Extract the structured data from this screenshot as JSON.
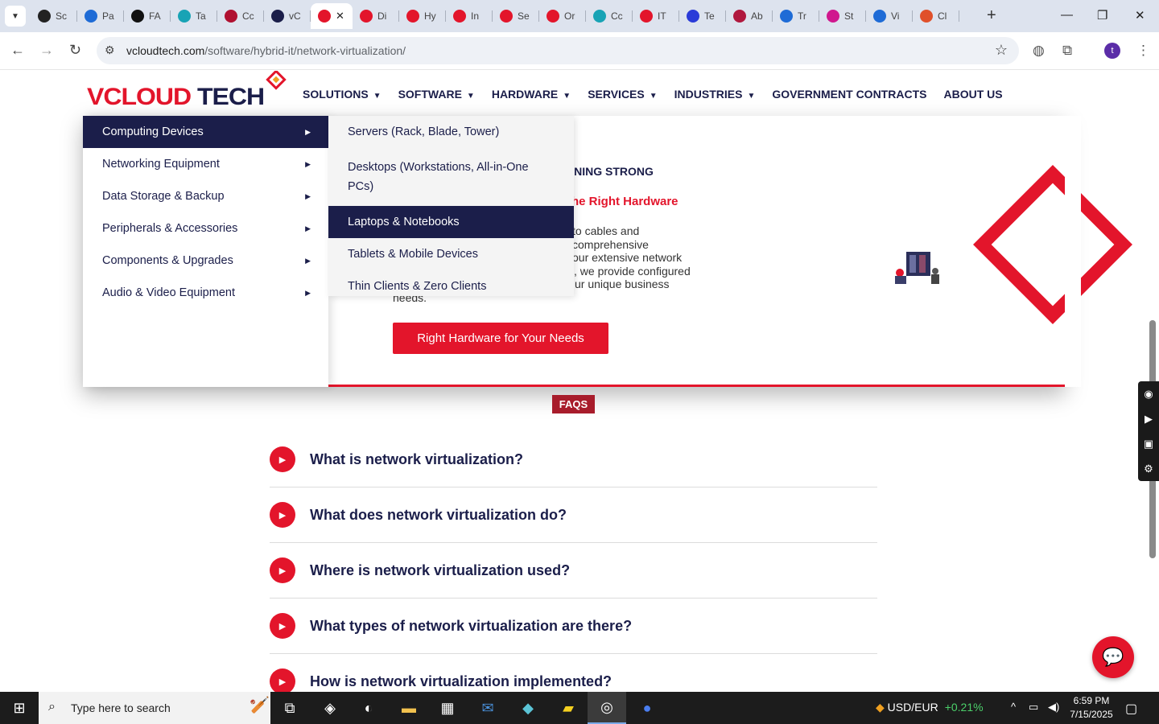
{
  "browser": {
    "tabs": [
      {
        "label": "Sc",
        "icon": "panda-icon",
        "color": "#222"
      },
      {
        "label": "Pa",
        "icon": "speed-icon",
        "color": "#1e6bd6"
      },
      {
        "label": "FA",
        "icon": "fa-icon",
        "color": "#111"
      },
      {
        "label": "Ta",
        "icon": "hex-icon",
        "color": "#18a3b5"
      },
      {
        "label": "Cc",
        "icon": "v-check-icon",
        "color": "#b01030"
      },
      {
        "label": "vC",
        "icon": "v-check-icon",
        "color": "#1b1e4a"
      },
      {
        "label": "",
        "icon": "vcloud-icon",
        "color": "#e3152b",
        "active": true
      },
      {
        "label": "Di",
        "icon": "vcloud-icon",
        "color": "#e3152b"
      },
      {
        "label": "Hy",
        "icon": "vcloud-icon",
        "color": "#e3152b"
      },
      {
        "label": "In",
        "icon": "vcloud-icon",
        "color": "#e3152b"
      },
      {
        "label": "Se",
        "icon": "vcloud-icon",
        "color": "#e3152b"
      },
      {
        "label": "Or",
        "icon": "vcloud-icon",
        "color": "#e3152b"
      },
      {
        "label": "Cc",
        "icon": "hex-icon",
        "color": "#18a3b5"
      },
      {
        "label": "IT",
        "icon": "vcloud-icon",
        "color": "#e3152b"
      },
      {
        "label": "Te",
        "icon": "x-icon",
        "color": "#2a3bd8"
      },
      {
        "label": "Ab",
        "icon": "brush-icon",
        "color": "#b0183e"
      },
      {
        "label": "Tr",
        "icon": "scale-icon",
        "color": "#1e6bd6"
      },
      {
        "label": "St",
        "icon": "pen-icon",
        "color": "#d0188e"
      },
      {
        "label": "Vi",
        "icon": "wave-icon",
        "color": "#1e6bd6"
      },
      {
        "label": "Cl",
        "icon": "claude-icon",
        "color": "#e0502a"
      }
    ],
    "url_host": "vcloudtech.com",
    "url_path": "/software/hybrid-it/network-virtualization/",
    "profile_initial": "t"
  },
  "site": {
    "logo_left": "VCLOUD",
    "logo_right": "TECH",
    "nav": [
      {
        "label": "SOLUTIONS",
        "dropdown": true
      },
      {
        "label": "SOFTWARE",
        "dropdown": true
      },
      {
        "label": "HARDWARE",
        "dropdown": true
      },
      {
        "label": "SERVICES",
        "dropdown": true
      },
      {
        "label": "INDUSTRIES",
        "dropdown": true
      },
      {
        "label": "GOVERNMENT CONTRACTS",
        "dropdown": false
      },
      {
        "label": "ABOUT US",
        "dropdown": false
      }
    ]
  },
  "menu": {
    "categories": [
      {
        "label": "Computing Devices",
        "active": true
      },
      {
        "label": "Networking Equipment"
      },
      {
        "label": "Data Storage & Backup"
      },
      {
        "label": "Peripherals & Accessories"
      },
      {
        "label": "Components & Upgrades"
      },
      {
        "label": "Audio & Video Equipment"
      }
    ],
    "subitems": [
      {
        "label": "Servers (Rack, Blade, Tower)"
      },
      {
        "label": "Desktops (Workstations, All-in-One PCs)"
      },
      {
        "label": "Laptops & Notebooks",
        "active": true
      },
      {
        "label": "Tablets & Mobile Devices"
      },
      {
        "label": "Thin Clients & Zero Clients"
      }
    ]
  },
  "hero": {
    "eyebrow": "NNING STRONG",
    "heading": "he Right Hardware",
    "body_lines": [
      "to cables and",
      "comprehensive",
      " our extensive network",
      ", we provide configured",
      "ur unique business",
      "needs."
    ],
    "cta": "Right Hardware for Your Needs"
  },
  "faq": {
    "badge": "FAQS",
    "questions": [
      "What is network virtualization?",
      "What does network virtualization do?",
      "Where is network virtualization used?",
      "What types of network virtualization are there?",
      "How is network virtualization implemented?"
    ]
  },
  "taskbar": {
    "search_placeholder": "Type here to search",
    "ticker_label": "USD/EUR",
    "ticker_change": "+0.21%",
    "time": "6:59 PM",
    "date": "7/15/2025"
  }
}
